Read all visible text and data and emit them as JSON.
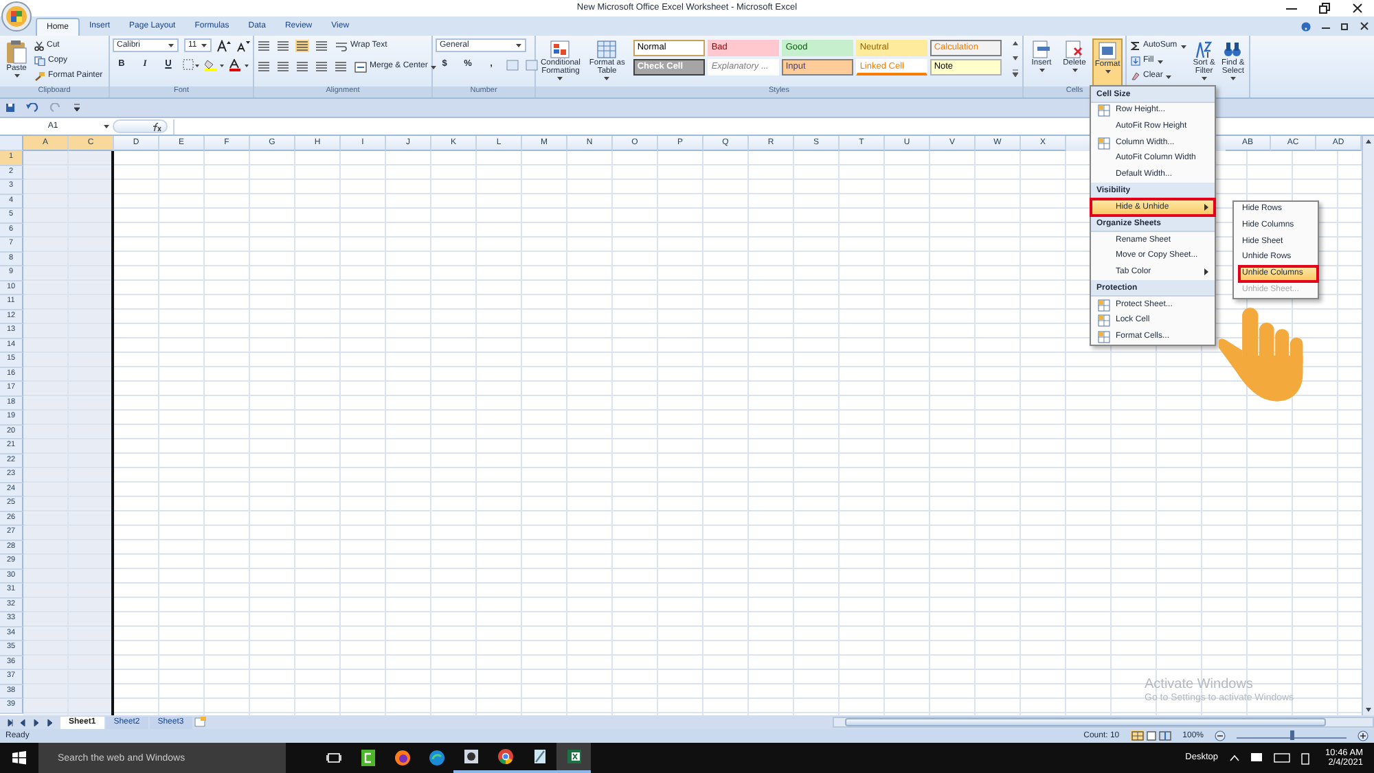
{
  "window": {
    "title": "New Microsoft Office Excel Worksheet - Microsoft Excel"
  },
  "tabs": [
    {
      "label": "Home",
      "selected": true
    },
    {
      "label": "Insert",
      "selected": false
    },
    {
      "label": "Page Layout",
      "selected": false
    },
    {
      "label": "Formulas",
      "selected": false
    },
    {
      "label": "Data",
      "selected": false
    },
    {
      "label": "Review",
      "selected": false
    },
    {
      "label": "View",
      "selected": false
    }
  ],
  "ribbon": {
    "clipboard": {
      "paste": "Paste",
      "items": [
        "Cut",
        "Copy",
        "Format Painter"
      ],
      "label": "Clipboard"
    },
    "font": {
      "name": "Calibri",
      "size": "11",
      "buttons": [
        "B",
        "I",
        "U"
      ],
      "label": "Font"
    },
    "alignment": {
      "wrap": "Wrap Text",
      "merge": "Merge & Center",
      "label": "Alignment"
    },
    "number": {
      "format": "General",
      "symbols": [
        "$",
        "%",
        ","
      ],
      "label": "Number"
    },
    "styles": {
      "buttons": [
        "Conditional Formatting",
        "Format as Table"
      ],
      "gallery": [
        {
          "label": "Normal",
          "kind": "normal"
        },
        {
          "label": "Bad",
          "kind": "bad"
        },
        {
          "label": "Good",
          "kind": "good"
        },
        {
          "label": "Neutral",
          "kind": "neutral"
        },
        {
          "label": "Calculation",
          "kind": "calculation"
        },
        {
          "label": "Check Cell",
          "kind": "check"
        },
        {
          "label": "Explanatory ...",
          "kind": "explanatory"
        },
        {
          "label": "Input",
          "kind": "input"
        },
        {
          "label": "Linked Cell",
          "kind": "linked"
        },
        {
          "label": "Note",
          "kind": "note"
        }
      ],
      "label": "Styles"
    },
    "cells": {
      "buttons": [
        {
          "label": "Insert",
          "selected": false
        },
        {
          "label": "Delete",
          "selected": false
        },
        {
          "label": "Format",
          "selected": true
        }
      ],
      "label": "Cells"
    },
    "editing": {
      "small": [
        "AutoSum",
        "Fill",
        "Clear"
      ],
      "big": [
        "Sort & Filter",
        "Find & Select"
      ]
    }
  },
  "formula_bar": {
    "name_box": "A1"
  },
  "grid": {
    "columns": [
      {
        "label": "A",
        "selected": true
      },
      {
        "label": "C",
        "selected": true
      },
      {
        "label": "D",
        "selected": false
      },
      {
        "label": "E",
        "selected": false
      },
      {
        "label": "F",
        "selected": false
      },
      {
        "label": "G",
        "selected": false
      },
      {
        "label": "H",
        "selected": false
      },
      {
        "label": "I",
        "selected": false
      },
      {
        "label": "J",
        "selected": false
      },
      {
        "label": "K",
        "selected": false
      },
      {
        "label": "L",
        "selected": false
      },
      {
        "label": "M",
        "selected": false
      },
      {
        "label": "N",
        "selected": false
      },
      {
        "label": "O",
        "selected": false
      },
      {
        "label": "P",
        "selected": false
      },
      {
        "label": "Q",
        "selected": false
      },
      {
        "label": "R",
        "selected": false
      },
      {
        "label": "S",
        "selected": false
      },
      {
        "label": "T",
        "selected": false
      },
      {
        "label": "U",
        "selected": false
      },
      {
        "label": "V",
        "selected": false
      },
      {
        "label": "W",
        "selected": false
      },
      {
        "label": "X",
        "selected": false
      }
    ],
    "columns_right": [
      {
        "label": "AB",
        "selected": false
      },
      {
        "label": "AC",
        "selected": false
      },
      {
        "label": "AD",
        "selected": false
      }
    ],
    "rows": [
      "1",
      "2",
      "3",
      "4",
      "5",
      "6",
      "7",
      "8",
      "9",
      "10",
      "11",
      "12",
      "13",
      "14",
      "15",
      "16",
      "17",
      "18",
      "19",
      "20",
      "21",
      "22",
      "23",
      "24",
      "25",
      "26",
      "27",
      "28",
      "29",
      "30",
      "31",
      "32",
      "33",
      "34",
      "35",
      "36",
      "37",
      "38",
      "39"
    ]
  },
  "sheets": [
    {
      "label": "Sheet1",
      "selected": true
    },
    {
      "label": "Sheet2",
      "selected": false
    },
    {
      "label": "Sheet3",
      "selected": false
    }
  ],
  "status_bar": {
    "text": "Ready",
    "count": "Count: 10",
    "views": [
      {
        "selected": true
      },
      {
        "selected": false
      },
      {
        "selected": false
      }
    ],
    "zoom": "100%",
    "zoom_slider": {
      "level": 0.5
    }
  },
  "format_menu": {
    "sections": [
      {
        "header": "Cell Size",
        "items": [
          {
            "label": "Row Height...",
            "has_icon": true,
            "submenu": false,
            "selected": false
          },
          {
            "label": "AutoFit Row Height",
            "has_icon": false,
            "submenu": false,
            "selected": false
          },
          {
            "label": "Column Width...",
            "has_icon": true,
            "submenu": false,
            "selected": false
          },
          {
            "label": "AutoFit Column Width",
            "has_icon": false,
            "submenu": false,
            "selected": false
          },
          {
            "label": "Default Width...",
            "has_icon": false,
            "submenu": false,
            "selected": false
          }
        ]
      },
      {
        "header": "Visibility",
        "items": [
          {
            "label": "Hide & Unhide",
            "has_icon": false,
            "submenu": true,
            "selected": true,
            "annotated": true
          }
        ]
      },
      {
        "header": "Organize Sheets",
        "items": [
          {
            "label": "Rename Sheet",
            "has_icon": false,
            "submenu": false,
            "selected": false
          },
          {
            "label": "Move or Copy Sheet...",
            "has_icon": false,
            "submenu": false,
            "selected": false
          },
          {
            "label": "Tab Color",
            "has_icon": false,
            "submenu": true,
            "selected": false
          }
        ]
      },
      {
        "header": "Protection",
        "items": [
          {
            "label": "Protect Sheet...",
            "has_icon": true,
            "submenu": false,
            "selected": false
          },
          {
            "label": "Lock Cell",
            "has_icon": true,
            "submenu": false,
            "selected": false
          },
          {
            "label": "Format Cells...",
            "has_icon": true,
            "submenu": false,
            "selected": false
          }
        ]
      }
    ]
  },
  "submenu": {
    "items": [
      {
        "label": "Hide Rows",
        "selected": false,
        "disabled": false
      },
      {
        "label": "Hide Columns",
        "selected": false,
        "disabled": false
      },
      {
        "label": "Hide Sheet",
        "selected": false,
        "disabled": false
      },
      {
        "label": "Unhide Rows",
        "selected": false,
        "disabled": false
      },
      {
        "label": "Unhide Columns",
        "selected": true,
        "disabled": false,
        "annotated": true
      },
      {
        "label": "Unhide Sheet...",
        "selected": false,
        "disabled": true
      }
    ]
  },
  "activation": {
    "title": "Activate Windows",
    "subtitle": "Go to Settings to activate Windows"
  },
  "taskbar": {
    "search_placeholder": "Search the web and Windows",
    "apps": [
      {
        "kind": "task-view",
        "running": false,
        "selected": false
      },
      {
        "kind": "green",
        "running": false,
        "selected": false
      },
      {
        "kind": "orange",
        "running": false,
        "selected": false
      },
      {
        "kind": "swirl",
        "running": false,
        "selected": false
      },
      {
        "kind": "photo",
        "running": true,
        "selected": false
      },
      {
        "kind": "ball",
        "running": true,
        "selected": false
      },
      {
        "kind": "pen",
        "running": true,
        "selected": false
      },
      {
        "kind": "sheet",
        "running": true,
        "selected": true
      }
    ],
    "desktop": "Desktop",
    "time": "10:46 AM",
    "date": "2/4/2021"
  }
}
